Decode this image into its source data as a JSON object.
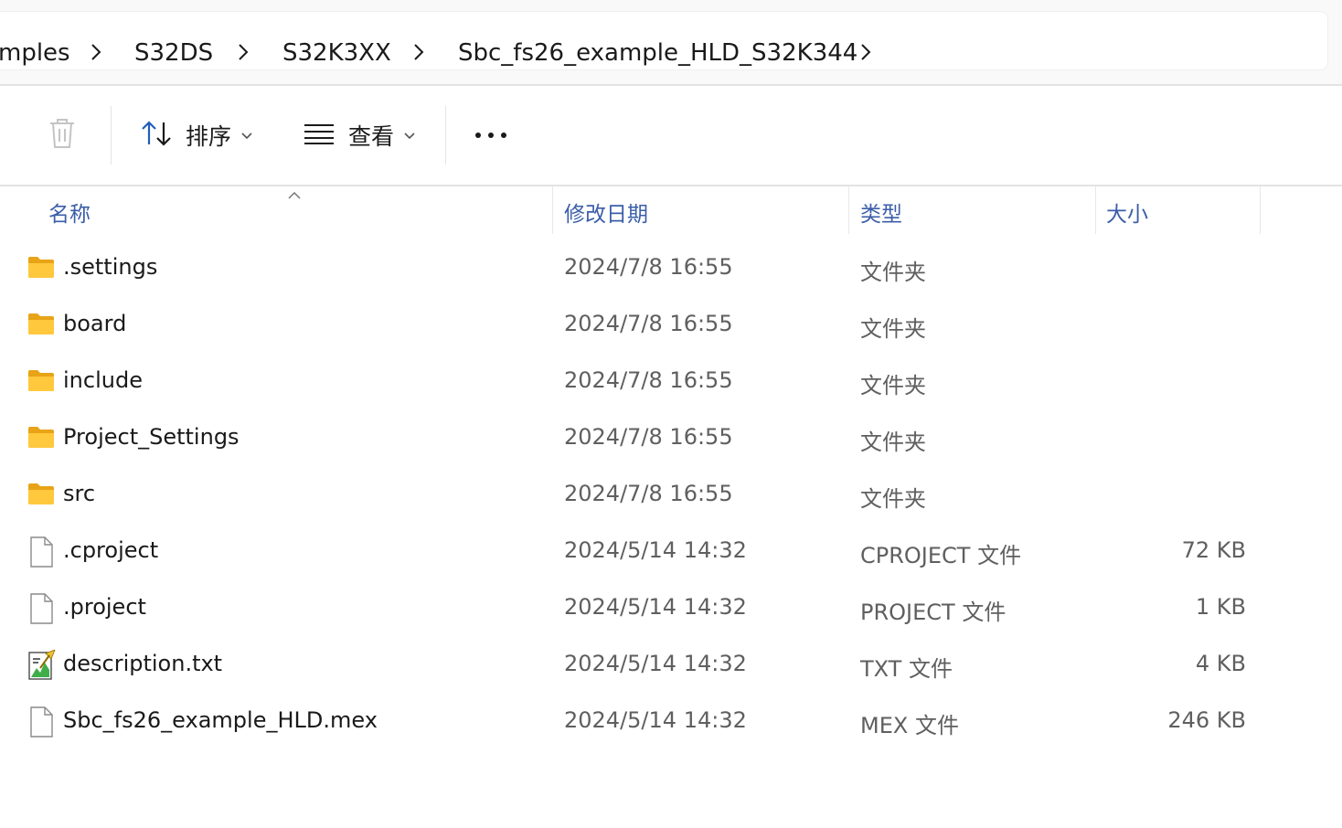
{
  "breadcrumb": {
    "items": [
      {
        "label": "mples"
      },
      {
        "label": "S32DS"
      },
      {
        "label": "S32K3XX"
      },
      {
        "label": "Sbc_fs26_example_HLD_S32K344"
      }
    ]
  },
  "toolbar": {
    "delete_icon": "trash-icon",
    "sort_label": "排序",
    "view_label": "查看",
    "more_icon": "more-icon"
  },
  "columns": {
    "name": "名称",
    "modified": "修改日期",
    "type": "类型",
    "size": "大小"
  },
  "files": [
    {
      "name": ".settings",
      "modified": "2024/7/8 16:55",
      "type": "文件夹",
      "size": "",
      "icon": "folder-icon"
    },
    {
      "name": "board",
      "modified": "2024/7/8 16:55",
      "type": "文件夹",
      "size": "",
      "icon": "folder-icon"
    },
    {
      "name": "include",
      "modified": "2024/7/8 16:55",
      "type": "文件夹",
      "size": "",
      "icon": "folder-icon"
    },
    {
      "name": "Project_Settings",
      "modified": "2024/7/8 16:55",
      "type": "文件夹",
      "size": "",
      "icon": "folder-icon"
    },
    {
      "name": "src",
      "modified": "2024/7/8 16:55",
      "type": "文件夹",
      "size": "",
      "icon": "folder-icon"
    },
    {
      "name": ".cproject",
      "modified": "2024/5/14 14:32",
      "type": "CPROJECT 文件",
      "size": "72 KB",
      "icon": "file-icon"
    },
    {
      "name": ".project",
      "modified": "2024/5/14 14:32",
      "type": "PROJECT 文件",
      "size": "1 KB",
      "icon": "file-icon"
    },
    {
      "name": "description.txt",
      "modified": "2024/5/14 14:32",
      "type": "TXT 文件",
      "size": "4 KB",
      "icon": "text-file-icon"
    },
    {
      "name": "Sbc_fs26_example_HLD.mex",
      "modified": "2024/5/14 14:32",
      "type": "MEX 文件",
      "size": "246 KB",
      "icon": "file-icon"
    }
  ]
}
